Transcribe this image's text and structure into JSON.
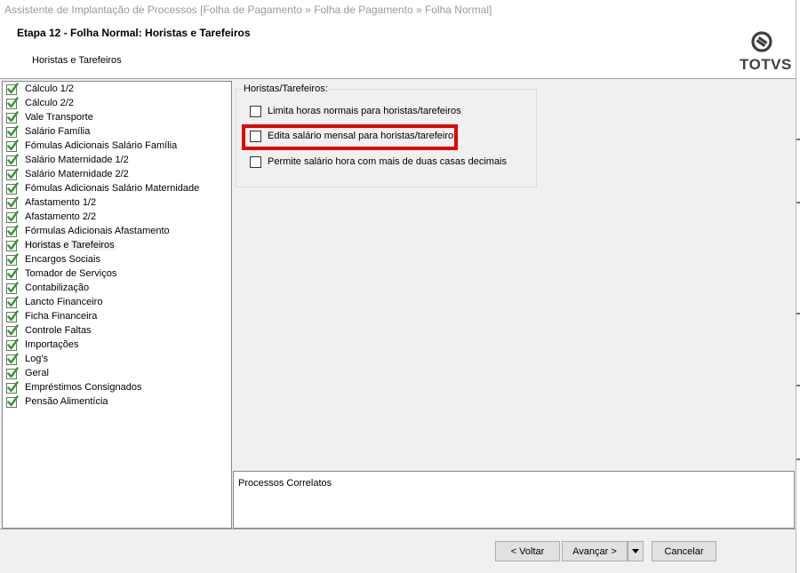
{
  "window": {
    "title": "Assistente de Implantação de Processos [Folha de Pagamento » Folha de Pagamento » Folha Normal]"
  },
  "header": {
    "step_title": "Etapa 12 - Folha Normal: Horistas e Tarefeiros",
    "subtitle": "Horistas e Tarefeiros",
    "logo_text": "TOTVS"
  },
  "steps": [
    {
      "label": "Cálculo 1/2",
      "icon": "green-check-icon"
    },
    {
      "label": "Cálculo 2/2",
      "icon": "green-check-icon"
    },
    {
      "label": "Vale Transporte",
      "icon": "green-check-icon"
    },
    {
      "label": "Salário Família",
      "icon": "green-check-icon"
    },
    {
      "label": "Fómulas Adicionais Salário Família",
      "icon": "green-check-icon"
    },
    {
      "label": "Salário Maternidade 1/2",
      "icon": "green-check-icon"
    },
    {
      "label": "Salário Maternidade 2/2",
      "icon": "green-check-icon"
    },
    {
      "label": "Fómulas Adicionais Salário Maternidade",
      "icon": "green-check-icon"
    },
    {
      "label": "Afastamento 1/2",
      "icon": "green-check-icon"
    },
    {
      "label": "Afastamento 2/2",
      "icon": "green-check-icon"
    },
    {
      "label": "Fórmulas Adicionais Afastamento",
      "icon": "green-check-icon"
    },
    {
      "label": "Horistas e Tarefeiros",
      "icon": "green-check-icon",
      "selected": true
    },
    {
      "label": "Encargos Sociais",
      "icon": "green-check-icon"
    },
    {
      "label": "Tomador de Serviços",
      "icon": "green-check-icon"
    },
    {
      "label": "Contabilização",
      "icon": "green-check-icon"
    },
    {
      "label": "Lancto Financeiro",
      "icon": "green-check-icon"
    },
    {
      "label": "Ficha Financeira",
      "icon": "green-check-icon"
    },
    {
      "label": "Controle Faltas",
      "icon": "green-check-icon"
    },
    {
      "label": "Importações",
      "icon": "green-check-icon"
    },
    {
      "label": "Log's",
      "icon": "green-check-icon"
    },
    {
      "label": "Geral",
      "icon": "green-check-icon"
    },
    {
      "label": "Empréstimos Consignados",
      "icon": "green-check-icon"
    },
    {
      "label": "Pensão Alimentícia",
      "icon": "green-check-icon"
    }
  ],
  "options_group": {
    "title": "Horistas/Tarefeiros:",
    "options": [
      {
        "label": "Limita horas normais para horistas/tarefeiros",
        "checked": false
      },
      {
        "label": "Edita salário mensal para horistas/tarefeiros",
        "checked": false,
        "highlighted": true
      },
      {
        "label": "Permite salário hora com mais de duas casas decimais",
        "checked": false
      }
    ]
  },
  "related": {
    "title": "Processos Correlatos"
  },
  "buttons": {
    "back": "< Voltar",
    "next": "Avançar >",
    "cancel": "Cancelar"
  },
  "colors": {
    "highlight": "#e00000",
    "check": "#2e9a2e"
  }
}
